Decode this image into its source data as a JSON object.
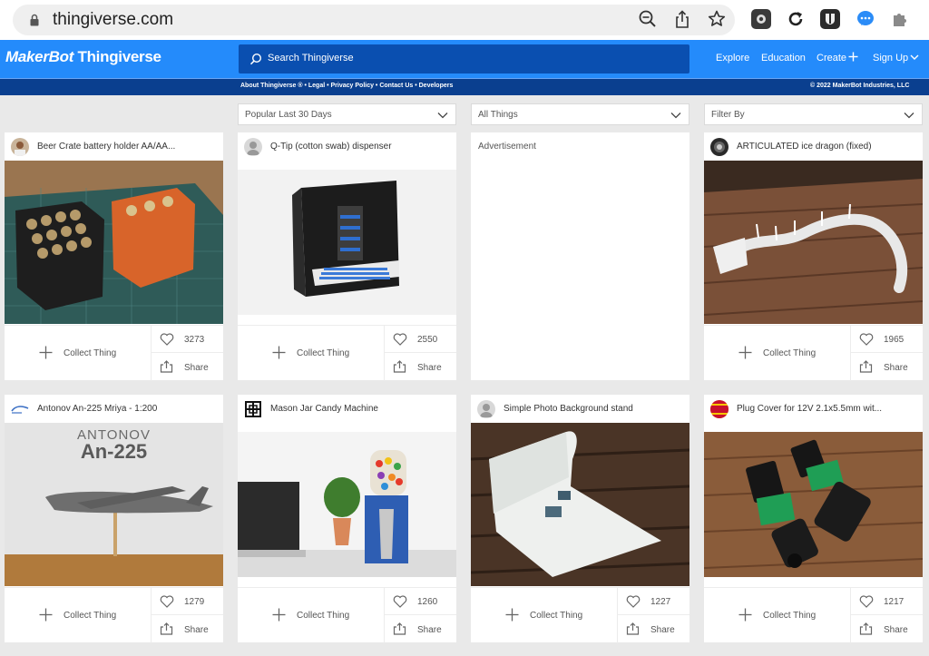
{
  "browser": {
    "url": "thingiverse.com",
    "tools": [
      "zoom-icon",
      "share-icon",
      "bookmark-star-icon"
    ],
    "extensions": [
      "extension-1",
      "extension-2",
      "extension-3",
      "extension-4",
      "puzzle-icon"
    ]
  },
  "header": {
    "logo_maker": "MakerBot",
    "logo_thing": "Thingiverse",
    "search_placeholder": "Search Thingiverse",
    "nav": {
      "explore": "Explore",
      "education": "Education",
      "create": "Create",
      "signup": "Sign Up"
    }
  },
  "subnav": {
    "links": "About Thingiverse ® • Legal • Privacy Policy • Contact Us • Developers",
    "copyright": "© 2022 MakerBot Industries, LLC"
  },
  "filters": {
    "sort": "Popular Last 30 Days",
    "type": "All Things",
    "filter_by": "Filter By"
  },
  "advertisement_label": "Advertisement",
  "card_labels": {
    "collect": "Collect Thing",
    "share": "Share"
  },
  "cards": [
    {
      "title": "Beer Crate battery holder AA/AA...",
      "likes": "3273"
    },
    {
      "title": "Q-Tip (cotton swab) dispenser",
      "likes": "2550"
    },
    {
      "title": "ARTICULATED ice dragon (fixed)",
      "likes": "1965"
    },
    {
      "title": "Antonov An-225 Mriya - 1:200",
      "likes": "1279"
    },
    {
      "title": "Mason Jar Candy Machine",
      "likes": "1260"
    },
    {
      "title": "Simple Photo Background stand",
      "likes": "1227"
    },
    {
      "title": "Plug Cover for 12V 2.1x5.5mm wit...",
      "likes": "1217"
    }
  ],
  "thumb_text": {
    "antonov_brand": "ANTONOV",
    "antonov_model": "An-225"
  },
  "colors": {
    "brand_blue": "#248bfb",
    "search_blue": "#0a4fb0",
    "subnav_blue": "#0a3f8f"
  }
}
